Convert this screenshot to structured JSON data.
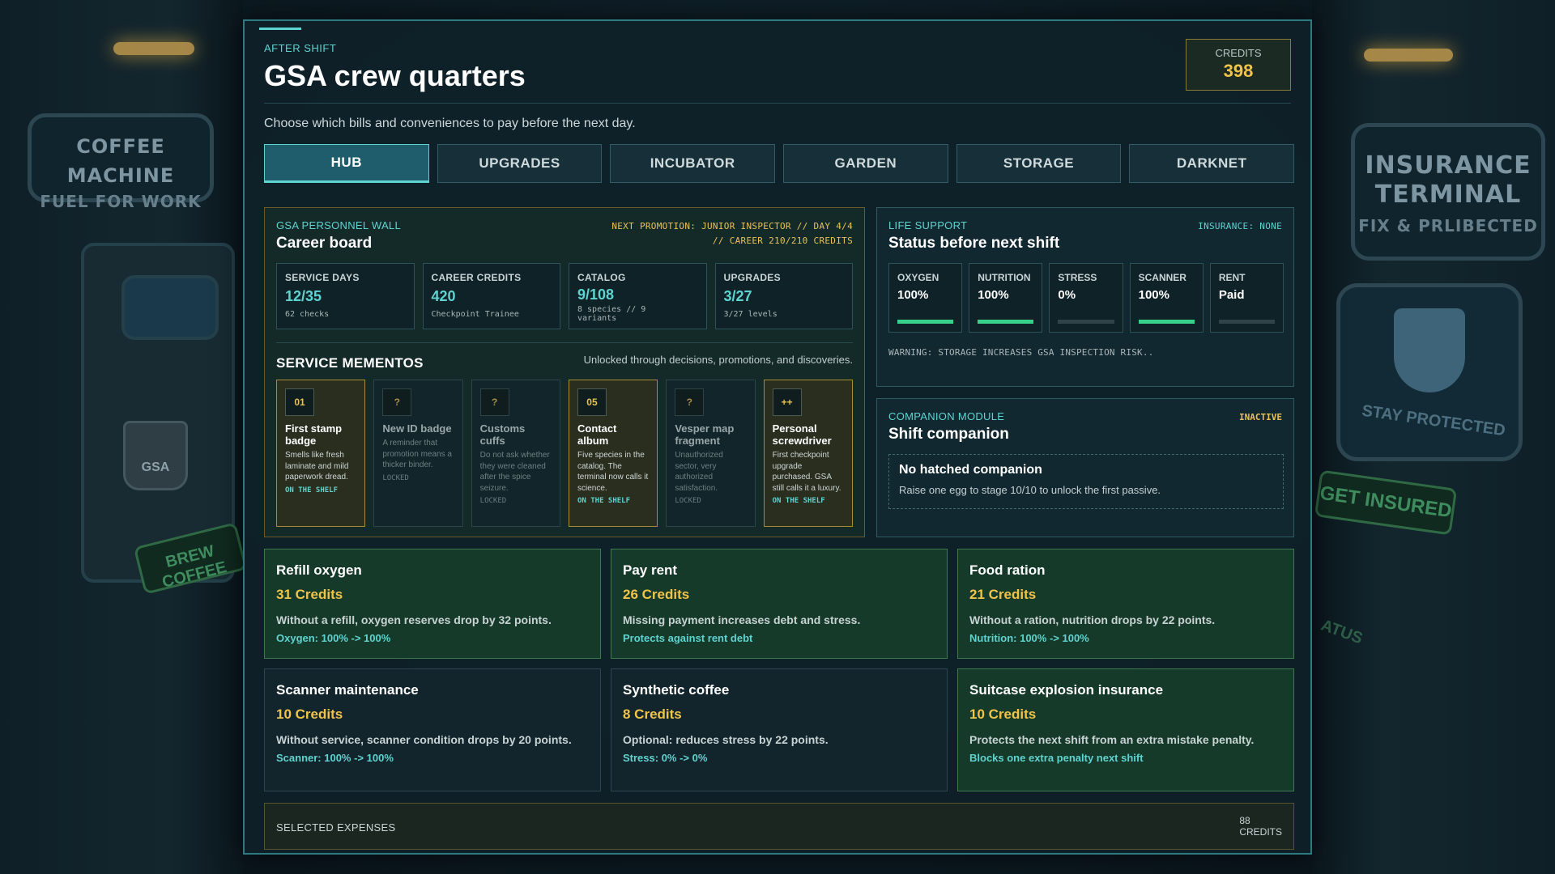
{
  "background": {
    "coffee_sign": {
      "line1": "COFFEE MACHINE",
      "line2": "FUEL FOR WORK"
    },
    "mug_label": "GSA",
    "brew_label": "BREW COFFEE",
    "insurance_sign": {
      "line1": "INSURANCE",
      "line2": "TERMINAL",
      "line3": "FIX & PRLIBECTED"
    },
    "stay_label": "STAY PROTECTED",
    "get_insured_label": "GET INSURED",
    "status_fragment": "ATUS",
    "accent_color": "#5fd3d0",
    "credit_color": "#f0c34a"
  },
  "header": {
    "kicker": "AFTER SHIFT",
    "title": "GSA crew quarters",
    "credits_label": "CREDITS",
    "credits_value": "398",
    "subtitle": "Choose which bills and conveniences to pay before the next day."
  },
  "tabs": [
    {
      "label": "HUB",
      "active": true
    },
    {
      "label": "UPGRADES",
      "active": false
    },
    {
      "label": "INCUBATOR",
      "active": false
    },
    {
      "label": "GARDEN",
      "active": false
    },
    {
      "label": "STORAGE",
      "active": false
    },
    {
      "label": "DARKNET",
      "active": false
    }
  ],
  "career": {
    "kicker": "GSA PERSONNEL WALL",
    "title": "Career board",
    "promo_line1": "NEXT PROMOTION: JUNIOR INSPECTOR // DAY 4/4",
    "promo_line2": "// CAREER 210/210 CREDITS",
    "stats": [
      {
        "label": "SERVICE DAYS",
        "value": "12/35",
        "sub": "62 checks"
      },
      {
        "label": "CAREER CREDITS",
        "value": "420",
        "sub": "Checkpoint Trainee"
      },
      {
        "label": "CATALOG",
        "value": "9/108",
        "sub": "8 species // 9 variants"
      },
      {
        "label": "UPGRADES",
        "value": "3/27",
        "sub": "3/27 levels"
      }
    ],
    "mementos_title": "SERVICE MEMENTOS",
    "mementos_note": "Unlocked through decisions, promotions, and discoveries.",
    "mementos": [
      {
        "num": "01",
        "name": "First stamp badge",
        "desc": "Smells like fresh laminate and mild paperwork dread.",
        "tag": "ON THE SHELF",
        "unlocked": true
      },
      {
        "num": "?",
        "name": "New ID badge",
        "desc": "A reminder that promotion means a thicker binder.",
        "tag": "LOCKED",
        "unlocked": false
      },
      {
        "num": "?",
        "name": "Customs cuffs",
        "desc": "Do not ask whether they were cleaned after the spice seizure.",
        "tag": "LOCKED",
        "unlocked": false
      },
      {
        "num": "05",
        "name": "Contact album",
        "desc": "Five species in the catalog. The terminal now calls it science.",
        "tag": "ON THE SHELF",
        "unlocked": true
      },
      {
        "num": "?",
        "name": "Vesper map fragment",
        "desc": "Unauthorized sector, very authorized satisfaction.",
        "tag": "LOCKED",
        "unlocked": false
      },
      {
        "num": "++",
        "name": "Personal screwdriver",
        "desc": "First checkpoint upgrade purchased. GSA still calls it a luxury.",
        "tag": "ON THE SHELF",
        "unlocked": true
      }
    ]
  },
  "life_support": {
    "kicker": "LIFE SUPPORT",
    "title": "Status before next shift",
    "insurance": "INSURANCE: NONE",
    "vitals": [
      {
        "label": "OXYGEN",
        "value": "100%",
        "level": 1.0
      },
      {
        "label": "NUTRITION",
        "value": "100%",
        "level": 1.0
      },
      {
        "label": "STRESS",
        "value": "0%",
        "level": 0.0
      },
      {
        "label": "SCANNER",
        "value": "100%",
        "level": 1.0
      },
      {
        "label": "RENT",
        "value": "Paid",
        "level": 0.0
      }
    ],
    "warning": "WARNING: STORAGE INCREASES GSA INSPECTION RISK.."
  },
  "companion": {
    "kicker": "COMPANION MODULE",
    "title": "Shift companion",
    "state": "INACTIVE",
    "box_title": "No hatched companion",
    "box_desc": "Raise one egg to stage 10/10 to unlock the first passive."
  },
  "expenses": [
    {
      "title": "Refill oxygen",
      "cost": "31 Credits",
      "desc": "Without a refill, oxygen reserves drop by 32 points.",
      "effect": "Oxygen: 100% -> 100%",
      "selected": true
    },
    {
      "title": "Pay rent",
      "cost": "26 Credits",
      "desc": "Missing payment increases debt and stress.",
      "effect": "Protects against rent debt",
      "selected": true
    },
    {
      "title": "Food ration",
      "cost": "21 Credits",
      "desc": "Without a ration, nutrition drops by 22 points.",
      "effect": "Nutrition: 100% -> 100%",
      "selected": true
    },
    {
      "title": "Scanner maintenance",
      "cost": "10 Credits",
      "desc": "Without service, scanner condition drops by 20 points.",
      "effect": "Scanner: 100% -> 100%",
      "selected": false
    },
    {
      "title": "Synthetic coffee",
      "cost": "8 Credits",
      "desc": "Optional: reduces stress by 22 points.",
      "effect": "Stress: 0% -> 0%",
      "selected": false
    },
    {
      "title": "Suitcase explosion insurance",
      "cost": "10 Credits",
      "desc": "Protects the next shift from an extra mistake penalty.",
      "effect": "Blocks one extra penalty next shift",
      "selected": true
    }
  ],
  "footer": {
    "label": "SELECTED EXPENSES",
    "amount": "88",
    "unit": "CREDITS"
  }
}
